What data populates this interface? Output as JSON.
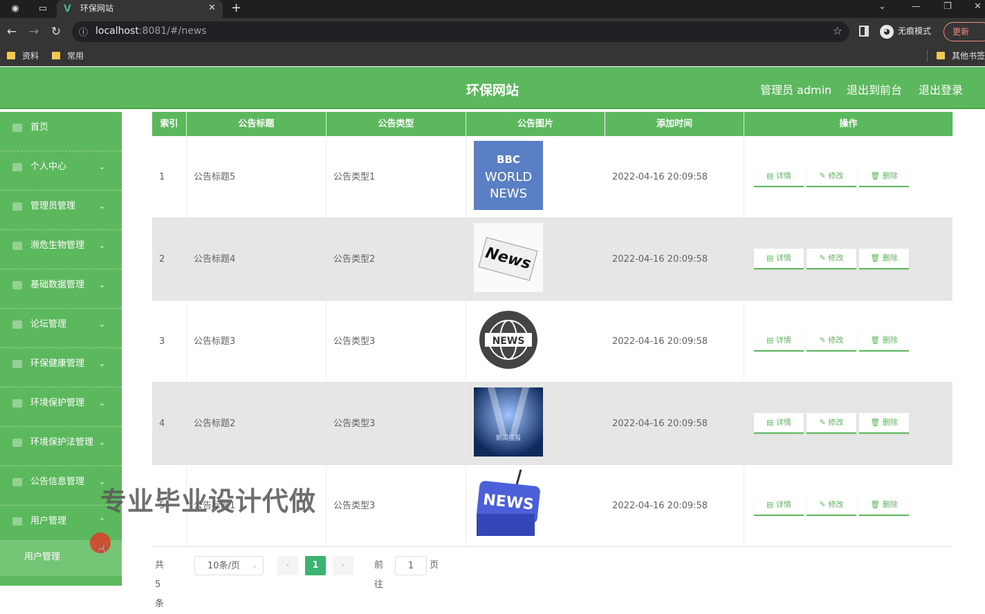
{
  "browser": {
    "tab_title": "环保网站",
    "url_host": "localhost",
    "url_rest": ":8081/#/news",
    "incognito_label": "无痕模式",
    "update_label": "更新",
    "bookmarks": [
      "资料",
      "常用"
    ],
    "other_bookmarks": "其他书签"
  },
  "header": {
    "title": "环保网站",
    "user": "管理员 admin",
    "to_front": "退出到前台",
    "logout": "退出登录"
  },
  "sidebar": {
    "items": [
      {
        "label": "首页",
        "chevron": ""
      },
      {
        "label": "个人中心",
        "chevron": "⌄"
      },
      {
        "label": "管理员管理",
        "chevron": "⌄"
      },
      {
        "label": "濒危生物管理",
        "chevron": "⌄"
      },
      {
        "label": "基础数据管理",
        "chevron": "⌄"
      },
      {
        "label": "论坛管理",
        "chevron": "⌄"
      },
      {
        "label": "环保健康管理",
        "chevron": "⌄"
      },
      {
        "label": "环境保护管理",
        "chevron": "⌄"
      },
      {
        "label": "环境保护法管理",
        "chevron": "⌄"
      },
      {
        "label": "公告信息管理",
        "chevron": "⌄"
      },
      {
        "label": "用户管理",
        "chevron": "⌃"
      }
    ],
    "submenu": "用户管理"
  },
  "table": {
    "headers": [
      "索引",
      "公告标题",
      "公告类型",
      "公告图片",
      "添加时间",
      "操作"
    ],
    "rows": [
      {
        "index": "1",
        "title": "公告标题5",
        "type": "公告类型1",
        "time": "2022-04-16 20:09:58",
        "image": "bbc-world-news"
      },
      {
        "index": "2",
        "title": "公告标题4",
        "type": "公告类型2",
        "time": "2022-04-16 20:09:58",
        "image": "news-paper"
      },
      {
        "index": "3",
        "title": "公告标题3",
        "type": "公告类型3",
        "time": "2022-04-16 20:09:58",
        "image": "news-globe"
      },
      {
        "index": "4",
        "title": "公告标题2",
        "type": "公告类型3",
        "time": "2022-04-16 20:09:58",
        "image": "news-stage"
      },
      {
        "index": "5",
        "title": "公告标题1",
        "type": "公告类型3",
        "time": "2022-04-16 20:09:58",
        "image": "news-key"
      }
    ],
    "actions": {
      "detail": "详情",
      "edit": "修改",
      "delete": "删除"
    }
  },
  "thumbs": {
    "bbc_1": "BBC",
    "bbc_2": "WORLD",
    "bbc_3": "NEWS",
    "paper": "News",
    "globe": "NEWS",
    "stage": "新闻播报",
    "key": "NEWS"
  },
  "watermark": "专业毕业设计代做",
  "pagination": {
    "total": "共 5 条",
    "page_size": "10条/页",
    "current": "1",
    "goto_label": "前往",
    "goto_value": "1",
    "page_unit": "页"
  },
  "colors": {
    "primary": "#5cb85c",
    "page_active": "#3cb371"
  }
}
